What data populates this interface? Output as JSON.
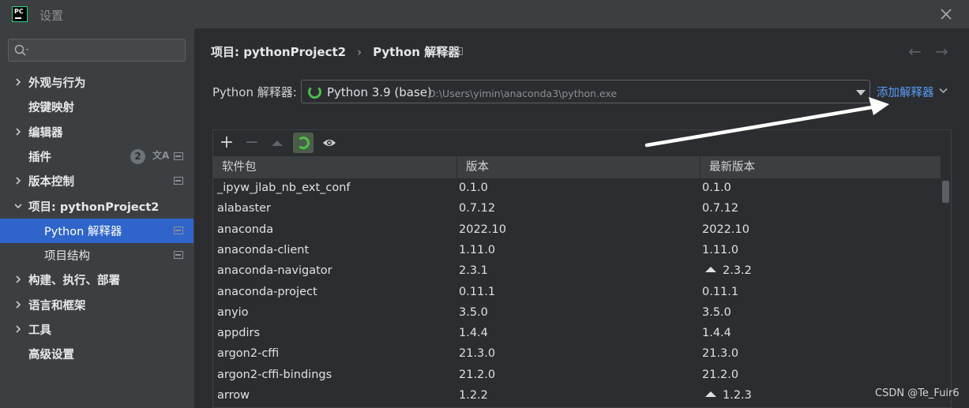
{
  "window": {
    "title": "设置"
  },
  "sidebar": {
    "search_placeholder": "",
    "items": [
      {
        "label": "外观与行为",
        "expandable": true
      },
      {
        "label": "按键映射",
        "expandable": false
      },
      {
        "label": "编辑器",
        "expandable": true
      },
      {
        "label": "插件",
        "expandable": false,
        "badge": "2",
        "translate_icon": "文A"
      },
      {
        "label": "版本控制",
        "expandable": true
      },
      {
        "label": "项目: pythonProject2",
        "expandable": true,
        "expanded": true
      },
      {
        "label": "Python 解释器",
        "sub": true,
        "selected": true
      },
      {
        "label": "项目结构",
        "sub": true
      },
      {
        "label": "构建、执行、部署",
        "expandable": true
      },
      {
        "label": "语言和框架",
        "expandable": true
      },
      {
        "label": "工具",
        "expandable": true
      },
      {
        "label": "高级设置",
        "expandable": false
      }
    ]
  },
  "breadcrumb": {
    "project": "项目: pythonProject2",
    "separator": "›",
    "page": "Python 解释器"
  },
  "interpreter": {
    "label": "Python 解释器:",
    "name": "Python 3.9 (base)",
    "path": "D:\\Users\\yimin\\anaconda3\\python.exe",
    "add_label": "添加解释器"
  },
  "toolbar": {
    "add": "+",
    "remove": "−"
  },
  "table": {
    "columns": [
      "软件包",
      "版本",
      "最新版本"
    ],
    "rows": [
      {
        "package": "_ipyw_jlab_nb_ext_conf",
        "version": "0.1.0",
        "latest": "0.1.0",
        "upgrade": false
      },
      {
        "package": "alabaster",
        "version": "0.7.12",
        "latest": "0.7.12",
        "upgrade": false
      },
      {
        "package": "anaconda",
        "version": "2022.10",
        "latest": "2022.10",
        "upgrade": false
      },
      {
        "package": "anaconda-client",
        "version": "1.11.0",
        "latest": "1.11.0",
        "upgrade": false
      },
      {
        "package": "anaconda-navigator",
        "version": "2.3.1",
        "latest": "2.3.2",
        "upgrade": true
      },
      {
        "package": "anaconda-project",
        "version": "0.11.1",
        "latest": "0.11.1",
        "upgrade": false
      },
      {
        "package": "anyio",
        "version": "3.5.0",
        "latest": "3.5.0",
        "upgrade": false
      },
      {
        "package": "appdirs",
        "version": "1.4.4",
        "latest": "1.4.4",
        "upgrade": false
      },
      {
        "package": "argon2-cffi",
        "version": "21.3.0",
        "latest": "21.3.0",
        "upgrade": false
      },
      {
        "package": "argon2-cffi-bindings",
        "version": "21.2.0",
        "latest": "21.2.0",
        "upgrade": false
      },
      {
        "package": "arrow",
        "version": "1.2.2",
        "latest": "1.2.3",
        "upgrade": true
      }
    ]
  },
  "watermark": "CSDN @Te_Fuir6",
  "colors": {
    "accent": "#2f65ca",
    "link": "#589df6",
    "spinner": "#4fbc4a",
    "background": "#2b2d30",
    "sidebar": "#3c3f41"
  }
}
